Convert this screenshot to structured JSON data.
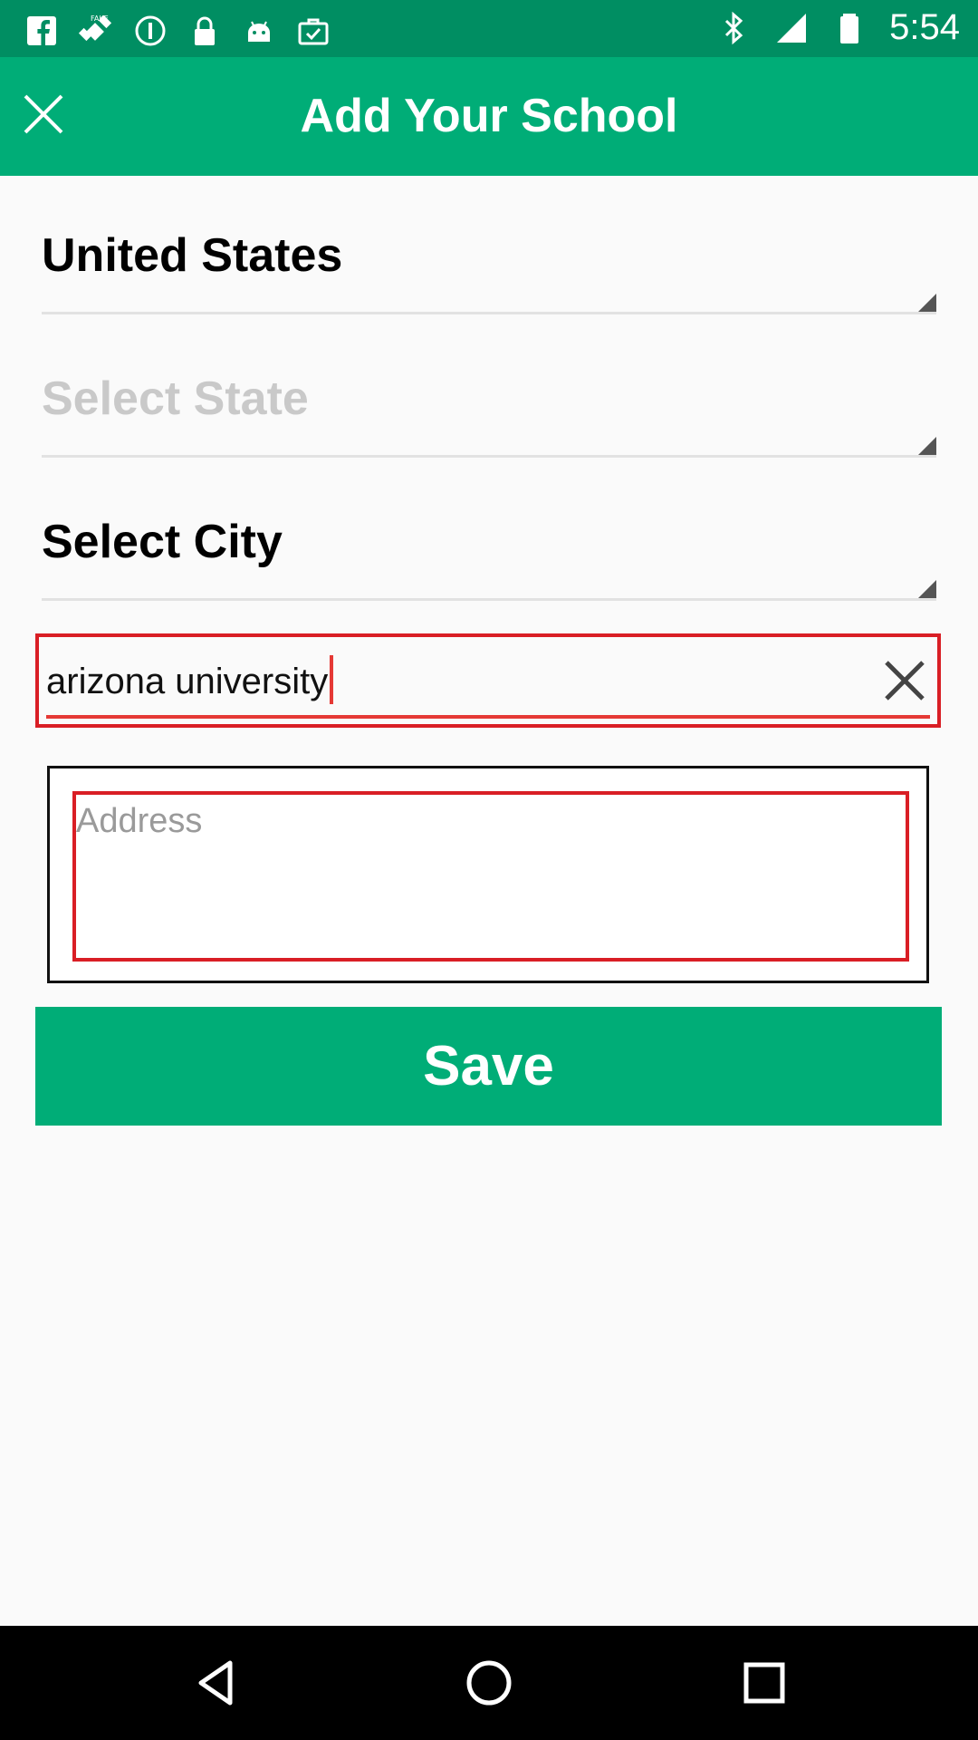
{
  "status_bar": {
    "time": "5:54",
    "icons": [
      "facebook-icon",
      "fake-gps-icon",
      "info-circle-icon",
      "lock-icon",
      "android-icon",
      "briefcase-check-icon",
      "bluetooth-icon",
      "signal-icon",
      "battery-icon"
    ]
  },
  "app_bar": {
    "title": "Add Your School",
    "close_icon": "close-icon",
    "color": "#00AD77"
  },
  "form": {
    "country": "United States",
    "state_placeholder": "Select State",
    "city": "Select City",
    "school_search_value": "arizona university",
    "address_placeholder": "Address",
    "save_label": "Save"
  },
  "nav_bar": {
    "icons": [
      "back-triangle-icon",
      "home-circle-icon",
      "recents-square-icon"
    ]
  }
}
